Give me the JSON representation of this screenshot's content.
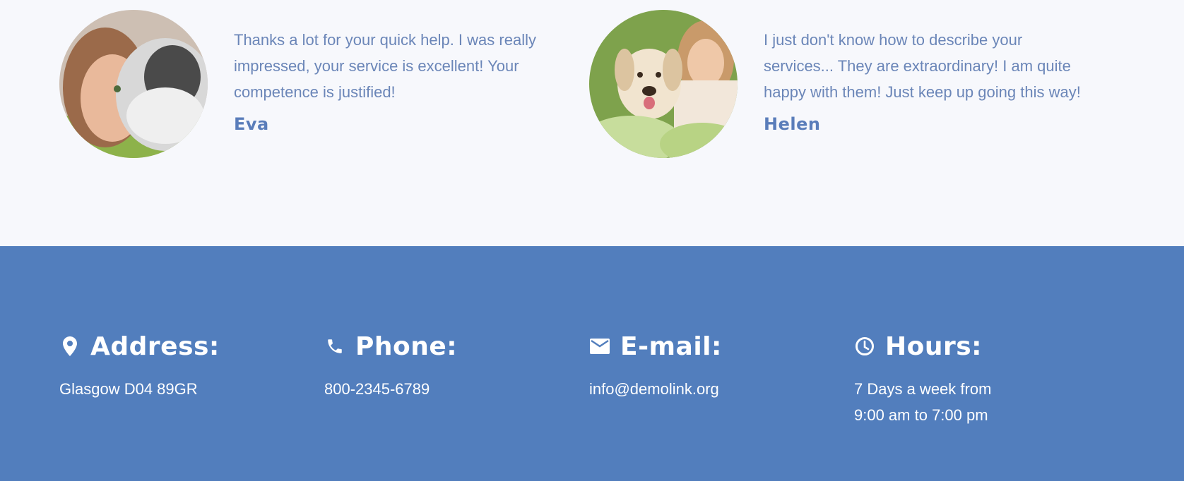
{
  "testimonials": [
    {
      "quote": "Thanks a lot for your quick help. I was really impressed, your service is excellent! Your competence is justified!",
      "author": "Eva",
      "avatar_icon": "woman-with-husky-photo"
    },
    {
      "quote": "I just don't know how to describe your services... They are extraordinary! I am quite happy with them! Just keep up going this way!",
      "author": "Helen",
      "avatar_icon": "woman-with-labrador-photo"
    }
  ],
  "contact": {
    "address": {
      "icon": "location-pin-icon",
      "title": "Address:",
      "text": "Glasgow D04 89GR"
    },
    "phone": {
      "icon": "phone-icon",
      "title": "Phone:",
      "text": "800-2345-6789"
    },
    "email": {
      "icon": "envelope-icon",
      "title": "E-mail:",
      "text": "info@demolink.org"
    },
    "hours": {
      "icon": "clock-icon",
      "title": "Hours:",
      "text": "7 Days a week from\n9:00 am to 7:00 pm"
    }
  },
  "colors": {
    "background": "#f7f8fc",
    "footer": "#527ebd",
    "quote_text": "#6b86b8",
    "author_text": "#5a7dba"
  }
}
